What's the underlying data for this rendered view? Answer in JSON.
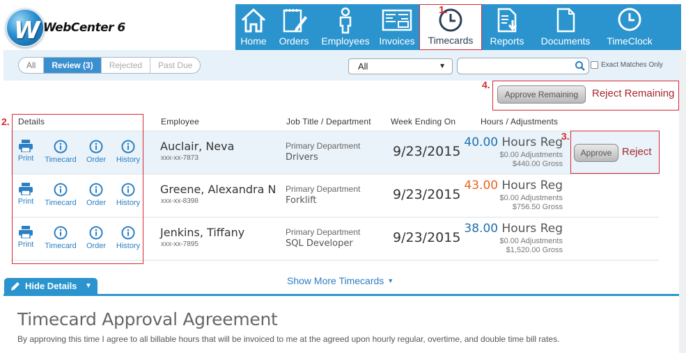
{
  "brand": {
    "logo_letter": "W",
    "name": "WebCenter 6"
  },
  "nav": {
    "items": [
      {
        "label": "Home",
        "icon": "home-icon"
      },
      {
        "label": "Orders",
        "icon": "notepad-pencil-icon"
      },
      {
        "label": "Employees",
        "icon": "person-icon"
      },
      {
        "label": "Invoices",
        "icon": "invoice-icon"
      },
      {
        "label": "Timecards",
        "icon": "clock-icon",
        "active": true
      },
      {
        "label": "Reports",
        "icon": "report-download-icon"
      },
      {
        "label": "Documents",
        "icon": "document-icon"
      },
      {
        "label": "TimeClock",
        "icon": "clock-icon"
      }
    ],
    "annotation": "1."
  },
  "filters": {
    "segments": [
      "All",
      "Review (3)",
      "Rejected",
      "Past Due"
    ],
    "active_segment": "Review (3)",
    "select_value": "All",
    "search_placeholder": "",
    "exact_matches_label": "Exact Matches Only"
  },
  "bulk_actions": {
    "annotation": "4.",
    "approve_remaining": "Approve Remaining",
    "reject_remaining": "Reject Remaining"
  },
  "table": {
    "annotation_details": "2.",
    "headers": {
      "details": "Details",
      "employee": "Employee",
      "job": "Job Title / Department",
      "week": "Week Ending On",
      "hours": "Hours / Adjustments"
    },
    "actions": [
      "Print",
      "Timecard",
      "Order",
      "History"
    ],
    "rows": [
      {
        "name": "Auclair, Neva",
        "ssn": "xxx-xx-7873",
        "dept": "Primary Department",
        "job": "Drivers",
        "week": "9/23/2015",
        "hours": "40.00",
        "hours_unit": "Hours Reg",
        "adjustments": "$0.00 Adjustments",
        "gross": "$440.00 Gross",
        "hours_color": "blue"
      },
      {
        "name": "Greene, Alexandra N",
        "ssn": "xxx-xx-8398",
        "dept": "Primary Department",
        "job": "Forklift",
        "week": "9/23/2015",
        "hours": "43.00",
        "hours_unit": "Hours Reg",
        "adjustments": "$0.00 Adjustments",
        "gross": "$756.50 Gross",
        "hours_color": "orange"
      },
      {
        "name": "Jenkins, Tiffany",
        "ssn": "xxx-xx-7895",
        "dept": "Primary Department",
        "job": "SQL Developer",
        "week": "9/23/2015",
        "hours": "38.00",
        "hours_unit": "Hours Reg",
        "adjustments": "$0.00 Adjustments",
        "gross": "$1,520.00 Gross",
        "hours_color": "blue"
      }
    ],
    "row_actions": {
      "annotation": "3.",
      "approve": "Approve",
      "reject": "Reject"
    },
    "show_more": "Show More Timecards"
  },
  "hide_details": "Hide Details",
  "agreement": {
    "title": "Timecard Approval Agreement",
    "text": "By approving this time I agree to all billable hours that will be invoiced to me at the agreed upon hourly regular, overtime, and double time bill rates."
  },
  "colors": {
    "nav_blue": "#2b94ce",
    "annotation_red": "#d9272e",
    "link_blue": "#2b7fc3",
    "hours_blue": "#1f6fae",
    "hours_orange": "#e8641c"
  }
}
